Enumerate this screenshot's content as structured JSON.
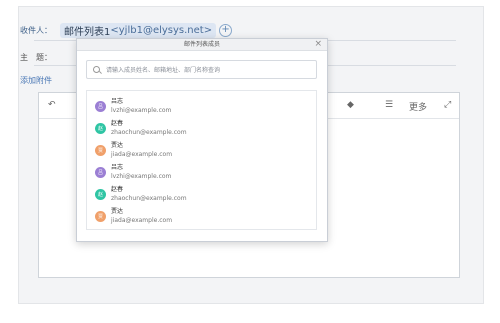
{
  "compose": {
    "recipient_label": "收件人：",
    "recipient_chip_name": "邮件列表1",
    "recipient_chip_email": "<yjlb1@elysys.net>",
    "add_symbol": "+",
    "subject_label": "主　题：",
    "attach_label": "添加附件"
  },
  "toolbar": {
    "more_label": "更多",
    "list_symbol": "☰",
    "fill_symbol": "◆",
    "expand_symbol": "⤢",
    "undo_symbol": "↶"
  },
  "modal": {
    "title": "邮件列表成员",
    "close_symbol": "×",
    "search_placeholder": "请输入成员姓名、邮箱地址、部门名称查询"
  },
  "members": [
    {
      "avatar": "吕",
      "name": "吕志",
      "email": "lvzhi@example.com",
      "color": "#9b7fd4"
    },
    {
      "avatar": "赵",
      "name": "赵春",
      "email": "zhaochun@example.com",
      "color": "#2fc5a4"
    },
    {
      "avatar": "贾",
      "name": "贾达",
      "email": "jiada@example.com",
      "color": "#f0a06a"
    },
    {
      "avatar": "吕",
      "name": "吕志",
      "email": "lvzhi@example.com",
      "color": "#9b7fd4"
    },
    {
      "avatar": "赵",
      "name": "赵春",
      "email": "zhaochun@example.com",
      "color": "#2fc5a4"
    },
    {
      "avatar": "贾",
      "name": "贾达",
      "email": "jiada@example.com",
      "color": "#f0a06a"
    }
  ]
}
